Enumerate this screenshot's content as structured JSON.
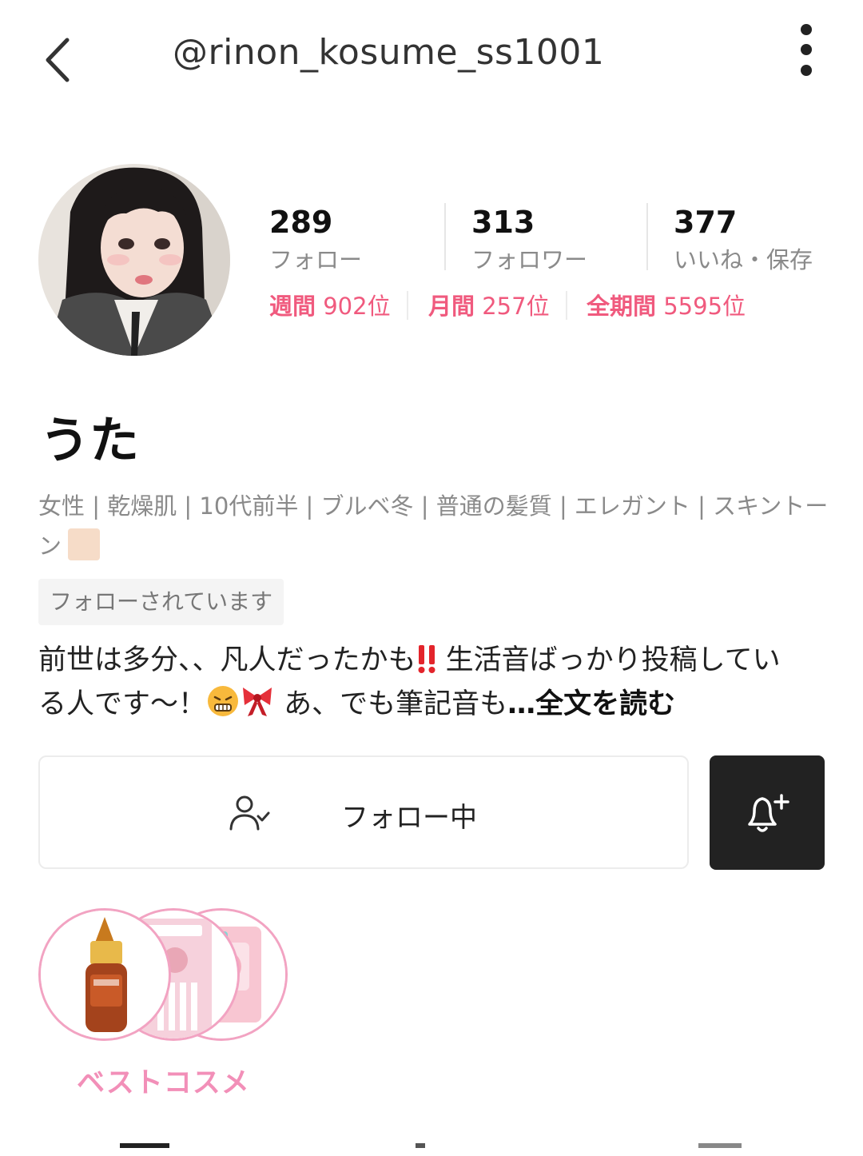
{
  "header": {
    "handle": "@rinon_kosume_ss1001"
  },
  "profile": {
    "name": "うた",
    "stats": [
      {
        "value": "289",
        "label": "フォロー"
      },
      {
        "value": "313",
        "label": "フォロワー"
      },
      {
        "value": "377",
        "label": "いいね・保存"
      }
    ],
    "ranks": [
      {
        "label": "週間",
        "value": "902位"
      },
      {
        "label": "月間",
        "value": "257位"
      },
      {
        "label": "全期間",
        "value": "5595位"
      }
    ],
    "tags_line1": "女性 | 乾燥肌 | 10代前半 | ブルベ冬 | 普通の髪質 | エレガント | スキントー",
    "tags_line2": "ン",
    "follows_you": "フォローされています",
    "bio_part1": "前世は多分、、凡人だったかも",
    "bio_part2": " 生活音ばっかり投稿してい",
    "bio_part3": "る人です〜！",
    "bio_part4": " あ、でも筆記音も",
    "bio_more": "…全文を読む"
  },
  "actions": {
    "follow_label": "フォロー中"
  },
  "best_cosme": {
    "label": "ベストコスメ"
  },
  "colors": {
    "rank_pink": "#f05a7e",
    "cosme_pink": "#f28fb8",
    "skin_tone": "#f6dcc8"
  }
}
